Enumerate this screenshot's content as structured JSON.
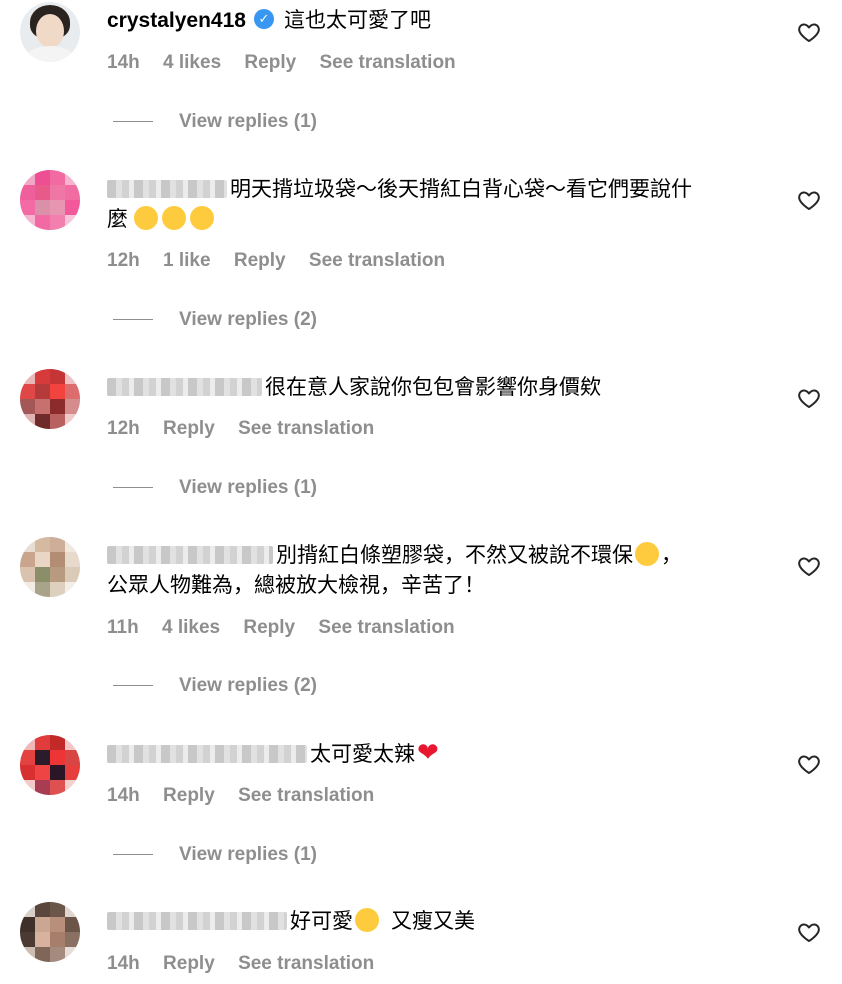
{
  "comments": [
    {
      "username": "crystalyen418",
      "verified": true,
      "text_lines": [
        "這也太可愛了吧"
      ],
      "time": "14h",
      "likes": "4 likes",
      "reply": "Reply",
      "translate": "See translation",
      "view_replies": "View replies (1)"
    },
    {
      "text_lines": [
        "明天揹垃圾袋～後天揹紅白背心袋～看它們要說什",
        "麼"
      ],
      "emojis": [
        "relieved-face",
        "relieved-face",
        "relieved-face"
      ],
      "time": "12h",
      "likes": "1 like",
      "reply": "Reply",
      "translate": "See translation",
      "view_replies": "View replies (2)"
    },
    {
      "text_lines": [
        "很在意人家說你包包會影響你身價欸"
      ],
      "time": "12h",
      "reply": "Reply",
      "translate": "See translation",
      "view_replies": "View replies (1)"
    },
    {
      "text_lines": [
        "別揹紅白條塑膠袋，不然又被說不環保",
        "，",
        "公眾人物難為，總被放大檢視，辛苦了！"
      ],
      "emojis": [
        "tears-of-joy"
      ],
      "time": "11h",
      "likes": "4 likes",
      "reply": "Reply",
      "translate": "See translation",
      "view_replies": "View replies (2)"
    },
    {
      "text_lines": [
        "太可愛太辣"
      ],
      "emojis": [
        "red-heart"
      ],
      "time": "14h",
      "reply": "Reply",
      "translate": "See translation",
      "view_replies": "View replies (1)"
    },
    {
      "text_lines": [
        "好可愛",
        "又瘦又美"
      ],
      "emojis": [
        "tears-of-joy"
      ],
      "time": "14h",
      "reply": "Reply",
      "translate": "See translation"
    }
  ],
  "colors": {
    "meta_gray": "#8e8e8e",
    "verified_blue": "#3897f0",
    "like_icon": "heart-outline-icon"
  }
}
